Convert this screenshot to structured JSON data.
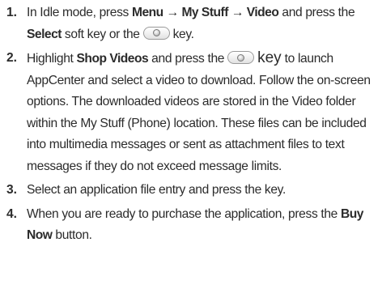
{
  "steps": [
    {
      "num": "1.",
      "t1": "In Idle mode, press ",
      "menu": "Menu",
      "arrow1": " → ",
      "mystuff": "My Stuff",
      "arrow2": " → ",
      "video": "Video",
      "t2": " and press the ",
      "select": "Select",
      "t3": " soft key or the ",
      "t4": " key."
    },
    {
      "num": "2.",
      "t1": "Highlight ",
      "shop": "Shop Videos",
      "t2": " and press the ",
      "key": "key",
      "t3": " to launch AppCenter and select a video to download. Follow the on-screen options. The downloaded videos are stored in the Video folder within the My Stuff (Phone) location. These files can be included into multimedia messages or sent as attachment files to text messages if they do not exceed message limits."
    },
    {
      "num": "3.",
      "text": "Select an application file entry and press the key."
    },
    {
      "num": "4.",
      "t1": "When you are ready to purchase the application, press the ",
      "buy": "Buy Now",
      "t2": " button."
    }
  ],
  "icons": {
    "ok_key": "ok-key-icon"
  }
}
